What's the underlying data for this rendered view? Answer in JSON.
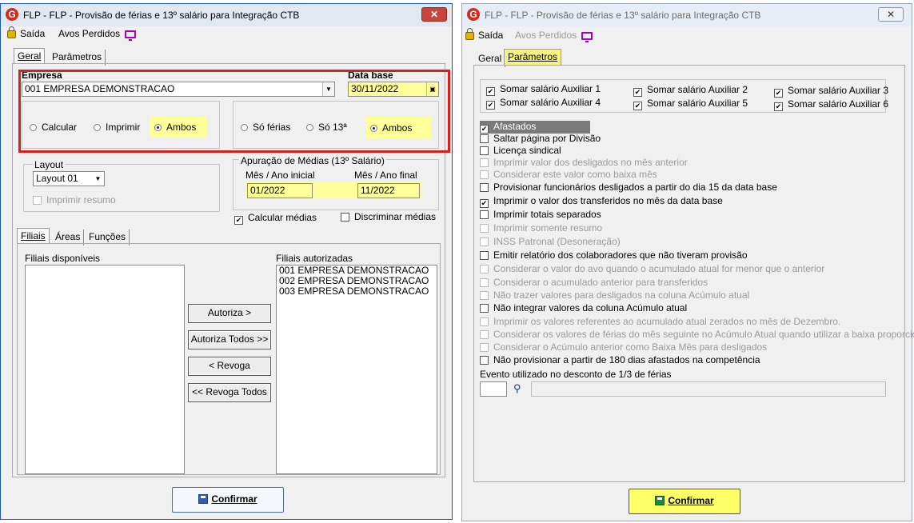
{
  "left": {
    "title": "FLP - FLP - Provisão de férias e 13º salário para Integração CTB",
    "menu": {
      "saida": "Saída",
      "avos": "Avos Perdidos"
    },
    "tabs": [
      "Geral",
      "Parâmetros"
    ],
    "empresa_label": "Empresa",
    "empresa_value": "001 EMPRESA DEMONSTRACAO",
    "database_label": "Data base",
    "database_value": "30/11/2022",
    "radios1": [
      "Calcular",
      "Imprimir",
      "Ambos"
    ],
    "radios2": [
      "Só férias",
      "Só 13ª",
      "Ambos"
    ],
    "layout_label": "Layout",
    "layout_value": "Layout 01",
    "imprimir_resumo": "Imprimir resumo",
    "apuracao_title": "Apuração de Médias (13º Salário)",
    "mes_inicial_label": "Mês / Ano inicial",
    "mes_final_label": "Mês / Ano final",
    "mes_inicial_value": "01/2022",
    "mes_final_value": "11/2022",
    "calcular_medias": "Calcular médias",
    "discriminar_medias": "Discriminar médias",
    "subtabs": [
      "Filiais",
      "Áreas",
      "Funções"
    ],
    "disponiveis_label": "Filiais disponíveis",
    "autorizadas_label": "Filiais autorizadas",
    "autorizadas": [
      "001 EMPRESA DEMONSTRACAO",
      "002 EMPRESA DEMONSTRACAO",
      "003 EMPRESA DEMONSTRACAO"
    ],
    "buttons": [
      "Autoriza >",
      "Autoriza Todos >>",
      "< Revoga",
      "<< Revoga Todos"
    ],
    "confirmar": "Confirmar"
  },
  "right": {
    "title": "FLP - FLP - Provisão de férias e 13º salário para Integração CTB",
    "menu": {
      "saida": "Saída",
      "avos": "Avos Perdidos"
    },
    "tabs": [
      "Geral",
      "Parâmetros"
    ],
    "aux": [
      "Somar salário Auxiliar 1",
      "Somar salário Auxiliar 2",
      "Somar salário Auxiliar 3",
      "Somar salário Auxiliar 4",
      "Somar salário Auxiliar 5",
      "Somar salário Auxiliar 6"
    ],
    "options": [
      {
        "label": "Afastados",
        "checked": true,
        "enabled": true
      },
      {
        "label": "Saltar página por Divisão",
        "checked": false,
        "enabled": true
      },
      {
        "label": "Licença sindical",
        "checked": false,
        "enabled": true
      },
      {
        "label": "Imprimir valor dos desligados no mês anterior",
        "checked": false,
        "enabled": false
      },
      {
        "label": "Considerar este valor como baixa mês",
        "checked": false,
        "enabled": false
      },
      {
        "label": "Provisionar funcionários desligados a partir do dia 15 da data base",
        "checked": false,
        "enabled": true
      },
      {
        "label": "Imprimir o valor dos transferidos no mês da data base",
        "checked": true,
        "enabled": true
      },
      {
        "label": "Imprimir totais separados",
        "checked": false,
        "enabled": true
      },
      {
        "label": "Imprimir somente resumo",
        "checked": false,
        "enabled": false
      },
      {
        "label": "INSS Patronal (Desoneração)",
        "checked": false,
        "enabled": false
      },
      {
        "label": "Emitir relatório dos colaboradores que não tiveram provisão",
        "checked": false,
        "enabled": true
      },
      {
        "label": "Considerar o valor do avo quando o acumulado atual for menor que o anterior",
        "checked": false,
        "enabled": false
      },
      {
        "label": "Considerar o acumulado anterior para transferidos",
        "checked": false,
        "enabled": false
      },
      {
        "label": "Não trazer valores para desligados na coluna Acúmulo atual",
        "checked": false,
        "enabled": false
      },
      {
        "label": "Não integrar valores da coluna Acúmulo atual",
        "checked": false,
        "enabled": true
      },
      {
        "label": "Imprimir os valores referentes ao acumulado atual zerados no mês de Dezembro.",
        "checked": false,
        "enabled": false
      },
      {
        "label": "Considerar os valores de férias do mês seguinte no Acúmulo Atual quando utilizar a baixa proporcional",
        "checked": false,
        "enabled": false
      },
      {
        "label": "Considerar o Acúmulo anterior como Baixa Mês para desligados",
        "checked": false,
        "enabled": false
      },
      {
        "label": "Não provisionar a partir de 180 dias afastados na competência",
        "checked": false,
        "enabled": true
      }
    ],
    "evento_label": "Evento utilizado no desconto de 1/3 de férias",
    "confirmar": "Confirmar"
  }
}
